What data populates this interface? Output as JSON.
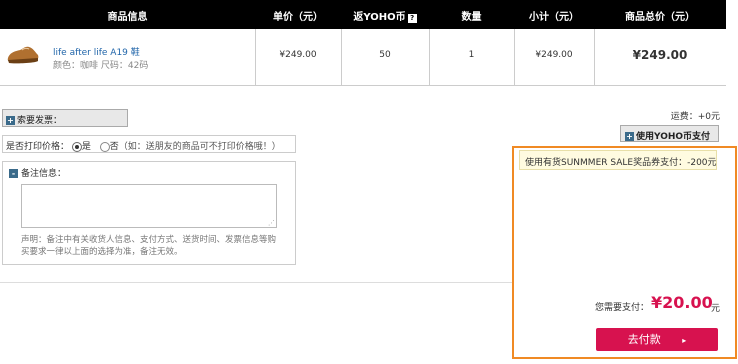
{
  "header": {
    "col_product": "商品信息",
    "col_price": "单价（元）",
    "col_yoho": "返YOHO币",
    "col_yoho_badge": "?",
    "col_qty": "数量",
    "col_subtotal": "小计（元）",
    "col_total": "商品总价（元）"
  },
  "product": {
    "name": "life after life A19 鞋",
    "attrs": "颜色：咖啡 尺码：42码",
    "price": "¥249.00",
    "yoho": "50",
    "qty": "1",
    "subtotal": "¥249.00",
    "total": "¥249.00"
  },
  "invoice": {
    "plus": "+",
    "label": "索要发票："
  },
  "print_price": {
    "label": "是否打印价格：",
    "yes": "是",
    "no": "否",
    "note": "（如：送朋友的商品可不打印价格哦！）"
  },
  "remark": {
    "minus": "-",
    "label": "备注信息：",
    "notice": "声明：备注中有关收货人信息、支付方式、送货时间、发票信息等购买要求一律以上面的选择为准，备注无效。"
  },
  "shipping": {
    "label": "运费：+0元"
  },
  "yoho_pay": {
    "plus": "+",
    "label": "使用YOHO币支付"
  },
  "coupon": {
    "label": "使用有货SUNMMER SALE奖品券支付：-200元"
  },
  "pay": {
    "label": "您需要支付：",
    "amount": "¥20.00",
    "unit": "元",
    "button": "去付款",
    "button_arrow": "▸"
  },
  "colors": {
    "accent": "#d7124f",
    "highlight_border": "#f08a24",
    "header_bg": "#000000"
  }
}
